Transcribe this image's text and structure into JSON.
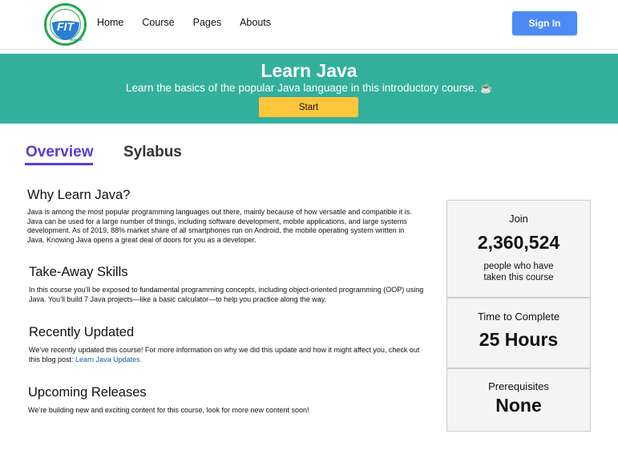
{
  "header": {
    "logo_text": "FIT",
    "logo_ring_text": "FACULTY OF INFORMATION TECHNOLOGY",
    "logo_sub": "HCMUTE",
    "nav": [
      "Home",
      "Course",
      "Pages",
      "Abouts"
    ],
    "signin_label": "Sign In"
  },
  "hero": {
    "title": "Learn Java",
    "subtitle": "Learn the basics of the popular Java language in this introductory course.",
    "subtitle_icon": "☕",
    "start_label": "Start",
    "bg_color": "#33b09c",
    "button_color": "#fec53d"
  },
  "tabs": {
    "overview": "Overview",
    "sylabus": "Sylabus",
    "active_color": "#5b3ad9"
  },
  "sections": [
    {
      "heading": "Why Learn Java?",
      "body": "Java is among the most popular programming languages out there, mainly because of how versatile and compatible it is. Java can be used for a large number of things, including software development, mobile applications, and large systems development. As of 2019, 88% market share of all smartphones run on Android, the mobile operating system written in Java. Knowing Java opens a great deal of doors for you as a developer."
    },
    {
      "heading": "Take-Away Skills",
      "body": "In this course you’ll be exposed to fundamental programming concepts, including object-oriented programming (OOP) using Java. You’ll build 7 Java projects—like a basic calculator—to help you practice along the way."
    },
    {
      "heading": "Recently Updated",
      "body": "We’ve recently updated this course! For more information on why we did this update and how it might affect you, check out this blog post: ",
      "link": "Learn Java Updates."
    },
    {
      "heading": "Upcoming Releases",
      "body": "We’re building new and exciting content for this course, look for more new content soon!"
    }
  ],
  "stats": {
    "join_label": "Join",
    "join_value": "2,360,524",
    "join_note": "people who have taken this course",
    "time_label": "Time to Complete",
    "time_value": "25 Hours",
    "prereq_label": "Prerequisites",
    "prereq_value": "None"
  },
  "colors": {
    "signin": "#4c8bf5",
    "link": "#1a5aa8"
  }
}
